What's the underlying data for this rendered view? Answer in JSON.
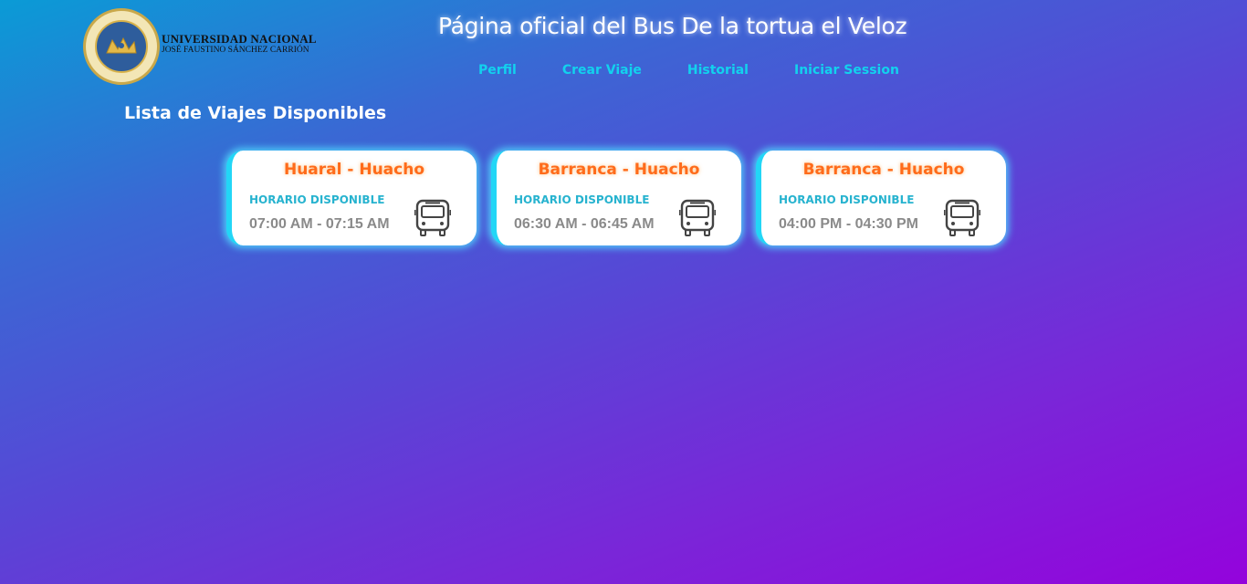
{
  "header": {
    "university_line1": "UNIVERSIDAD NACIONAL",
    "university_line2": "JOSÉ FAUSTINO SÁNCHEZ CARRIÓN",
    "title": "Página oficial del Bus De la tortua el Veloz"
  },
  "nav": {
    "items": [
      {
        "label": "Perfil"
      },
      {
        "label": "Crear Viaje"
      },
      {
        "label": "Historial"
      },
      {
        "label": "Iniciar Session"
      }
    ]
  },
  "main": {
    "section_title": "Lista de Viajes Disponibles",
    "trips": [
      {
        "route": "Huaral - Huacho",
        "label": "HORARIO DISPONIBLE",
        "time": "07:00 AM - 07:15 AM",
        "icon": "bus-icon"
      },
      {
        "route": "Barranca - Huacho",
        "label": "HORARIO DISPONIBLE",
        "time": "06:30 AM - 06:45 AM",
        "icon": "bus-icon"
      },
      {
        "route": "Barranca - Huacho",
        "label": "HORARIO DISPONIBLE",
        "time": "04:00 PM - 04:30 PM",
        "icon": "bus-icon"
      }
    ]
  },
  "colors": {
    "gradient_start": "#0a9bd6",
    "gradient_end": "#9403dc",
    "nav_link": "#12d2ee",
    "route_text": "#ff6b1a",
    "schedule_label": "#27b3cf",
    "time_text": "#8a8a8a",
    "card_glow": "#22d6f6"
  }
}
